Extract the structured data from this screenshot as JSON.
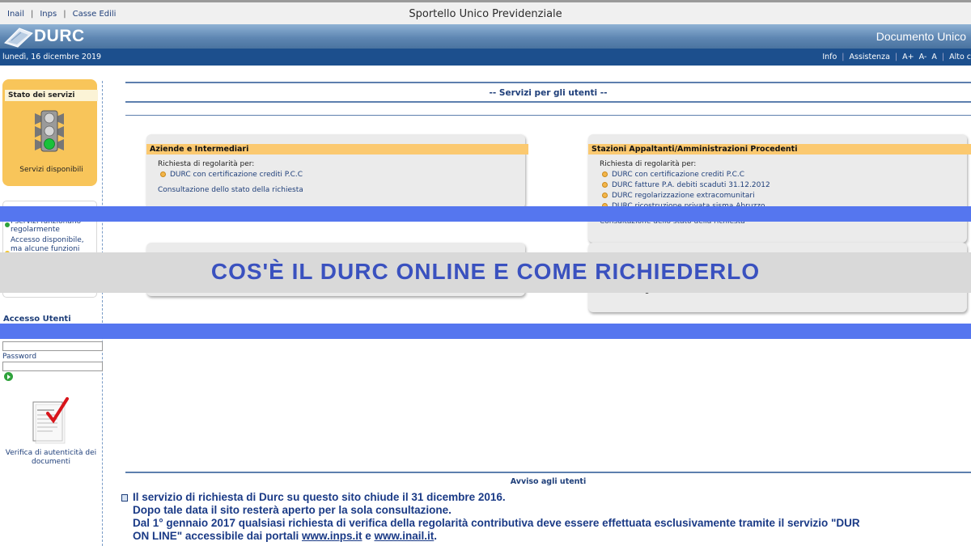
{
  "top": {
    "links": [
      "Inail",
      "Inps",
      "Casse Edili"
    ],
    "title": "Sportello Unico Previdenziale"
  },
  "banner": {
    "logo": "DURC",
    "right_text": "Documento Unico"
  },
  "nav": {
    "date": "lunedì, 16 dicembre 2019",
    "info": "Info",
    "assistenza": "Assistenza",
    "font_plus": "A+",
    "font_minus": "A-",
    "font_normal": "A",
    "contrast": "Alto c"
  },
  "sidebar": {
    "stato_title": "Stato dei servizi",
    "stato_label": "Servizi disponibili",
    "legend": [
      "I servizi funzionano",
      "regolarmente",
      "Accesso disponibile,",
      "ma alcune funzioni"
    ],
    "accesso_title": "Accesso Utenti",
    "password_label": "Password",
    "verifica_label_1": "Verifica di autenticità dei",
    "verifica_label_2": "documenti"
  },
  "main": {
    "heading": "-- Servizi per gli utenti --",
    "aziende": {
      "title": "Aziende e Intermediari",
      "intro": "Richiesta di regolarità per:",
      "items": [
        "DURC con certificazione crediti P.C.C"
      ],
      "consultazione": "Consultazione dello stato della richiesta"
    },
    "stazioni": {
      "title": "Stazioni Appaltanti/Amministrazioni Procedenti",
      "intro": "Richiesta di regolarità per:",
      "items": [
        "DURC con certificazione crediti P.C.C",
        "DURC fatture P.A. debiti scaduti 31.12.2012",
        "DURC regolarizzazione extracomunitari",
        "DURC ricostruzione privata sisma Abruzzo"
      ],
      "consultazione": "Consultazione dello stato della richiesta",
      "extra": "autorizzati agli istituti Previdenziali e Casse Edili"
    }
  },
  "overlay": {
    "title": "COS'È IL DURC ONLINE E COME RICHIEDERLO"
  },
  "avviso": {
    "title": "Avviso agli utenti",
    "line1": "Il servizio di richiesta di Durc su questo sito chiude il 31 dicembre 2016.",
    "line2": "Dopo tale data il sito resterà aperto per la sola consultazione.",
    "line3": "Dal 1° gennaio 2017 qualsiasi richiesta di verifica della regolarità contributiva deve essere effettuata esclusivamente tramite il servizio \"DUR",
    "line4_a": "ON LINE\" accessibile dai portali ",
    "link_inps": "www.inps.it",
    "line4_b": " e ",
    "link_inail": "www.inail.it",
    "line4_c": "."
  },
  "colors": {
    "navbar": "#1c4f8d",
    "accent_orange": "#fbc970",
    "overlay_blue": "#5576ef",
    "overlay_text": "#3a51bf",
    "status_green": "#2fa23c"
  }
}
